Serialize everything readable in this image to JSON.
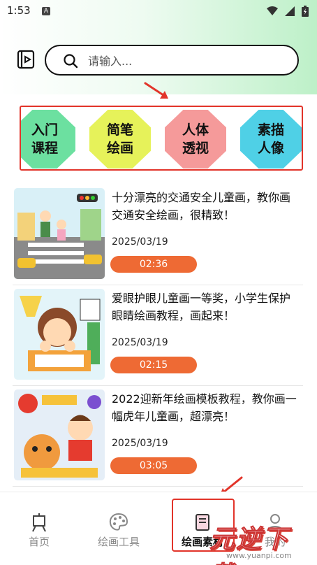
{
  "status_bar": {
    "time": "1:53",
    "notif_letter": "A"
  },
  "search": {
    "placeholder": "请输入..."
  },
  "categories": [
    {
      "line1": "入门",
      "line2": "课程",
      "color": "#6ce0a0"
    },
    {
      "line1": "简笔",
      "line2": "绘画",
      "color": "#e6f25a"
    },
    {
      "line1": "人体",
      "line2": "透视",
      "color": "#f59a9a"
    },
    {
      "line1": "素描",
      "line2": "人像",
      "color": "#4fd0e6"
    }
  ],
  "articles": [
    {
      "title": "十分漂亮的交通安全儿童画，教你画交通安全绘画，很精致！",
      "date": "2025/03/19",
      "duration": "02:36"
    },
    {
      "title": "爱眼护眼儿童画一等奖，小学生保护眼睛绘画教程，画起来！",
      "date": "2025/03/19",
      "duration": "02:15"
    },
    {
      "title": "2022迎新年绘画模板教程，教你画一幅虎年儿童画，超漂亮！",
      "date": "2025/03/19",
      "duration": "03:05"
    }
  ],
  "tabs": [
    {
      "label": "首页",
      "icon": "easel-icon"
    },
    {
      "label": "绘画工具",
      "icon": "palette-icon"
    },
    {
      "label": "绘画素材",
      "icon": "book-icon"
    },
    {
      "label": "我的",
      "icon": "user-icon"
    }
  ],
  "watermark": {
    "logo": "元逆下载",
    "url": "www.yuanpi.com"
  },
  "colors": {
    "accent": "#ee6a34",
    "highlight": "#e2342a"
  }
}
